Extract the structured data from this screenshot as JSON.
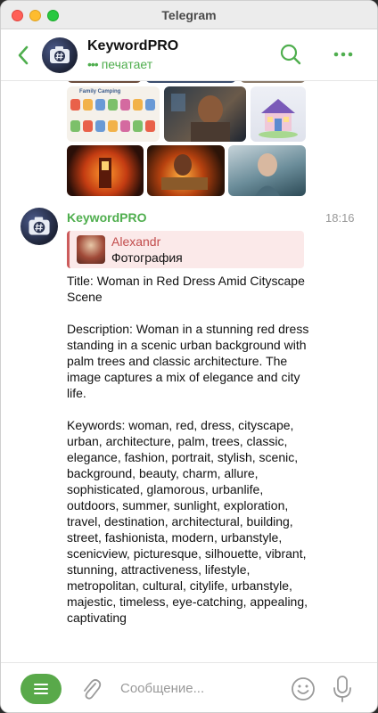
{
  "window": {
    "title": "Telegram"
  },
  "header": {
    "name": "KeywordPRO",
    "status": "печатает",
    "typing_dots": "•••"
  },
  "icons": {
    "back": "chevron-left-icon",
    "search": "search-icon",
    "more": "more-dots-icon",
    "menu": "menu-icon",
    "attach": "paperclip-icon",
    "emoji": "smiley-icon",
    "mic": "microphone-icon"
  },
  "colors": {
    "accent": "#4fae4e",
    "menu_button": "#59a94a",
    "reply_bar": "#cc5c5c",
    "reply_bg": "#fbe9e9"
  },
  "media": {
    "collage_title": "Family Camping"
  },
  "message": {
    "sender": "KeywordPRO",
    "time": "18:16",
    "reply": {
      "name": "Alexandr",
      "text": "Фотография"
    },
    "title": "Title: Woman in Red Dress Amid Cityscape Scene",
    "description": "Description: Woman in a stunning red dress standing in a scenic urban background with palm trees and classic architecture. The image captures a mix of elegance and city life.",
    "keywords": "Keywords: woman, red, dress, cityscape, urban, architecture, palm, trees, classic, elegance, fashion, portrait, stylish, scenic, background, beauty, charm, allure, sophisticated, glamorous, urbanlife, outdoors, summer, sunlight, exploration, travel, destination, architectural, building, street, fashionista, modern, urbanstyle, scenicview, picturesque, silhouette, vibrant, stunning, attractiveness, lifestyle, metropolitan, cultural, citylife, urbanstyle, majestic, timeless, eye-catching, appealing, captivating"
  },
  "composer": {
    "placeholder": "Сообщение..."
  }
}
